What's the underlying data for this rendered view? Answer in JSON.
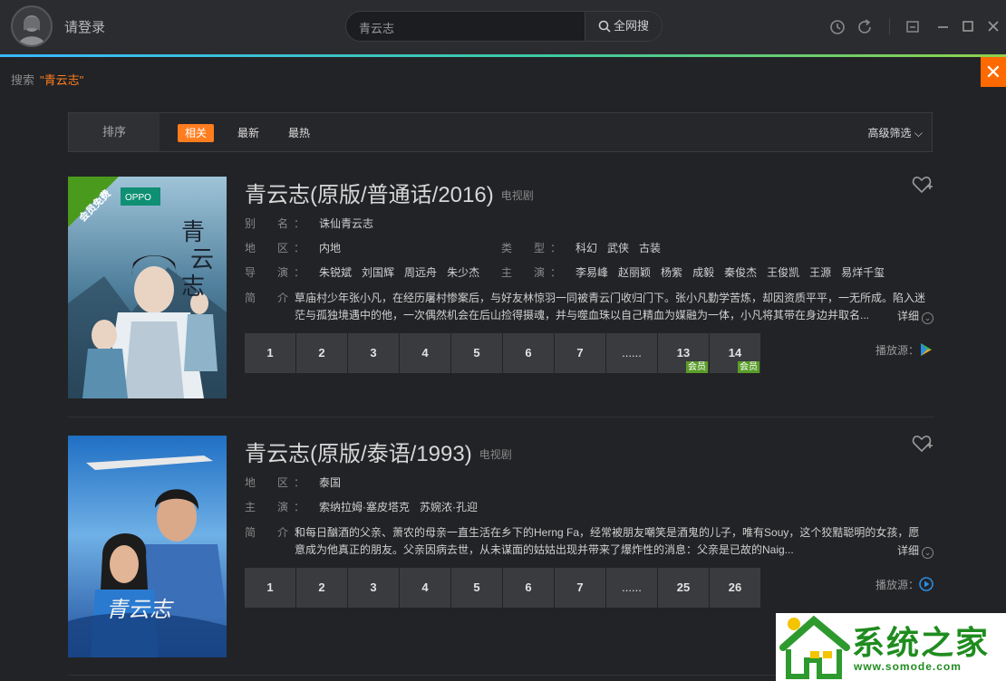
{
  "header": {
    "login_label": "请登录",
    "search_value": "青云志",
    "search_button_label": "全网搜"
  },
  "breadcrumb": {
    "label": "搜索",
    "query": "\"青云志\""
  },
  "sort": {
    "label": "排序",
    "options": [
      "相关",
      "最新",
      "最热"
    ],
    "active": "相关",
    "advanced_label": "高级筛选"
  },
  "results": [
    {
      "title": "青云志(原版/普通话/2016)",
      "type": "电视剧",
      "alias_key": "别　名：",
      "alias": "诛仙青云志",
      "region_key": "地　区：",
      "region": "内地",
      "genre_key": "类　型：",
      "genres": [
        "科幻",
        "武侠",
        "古装"
      ],
      "director_key": "导　演：",
      "directors": [
        "朱锐斌",
        "刘国辉",
        "周远舟",
        "朱少杰"
      ],
      "cast_key": "主　演：",
      "cast": [
        "李易峰",
        "赵丽颖",
        "杨紫",
        "成毅",
        "秦俊杰",
        "王俊凯",
        "王源",
        "易烊千玺"
      ],
      "desc_key": "简　介：",
      "description": "草庙村少年张小凡，在经历屠村惨案后，与好友林惊羽一同被青云门收归门下。张小凡勤学苦炼，却因资质平平，一无所成。陷入迷茫与孤独境遇中的他，一次偶然机会在后山捡得摄魂，并与噬血珠以自己精血为媒融为一体，小凡将其带在身边并取名...",
      "detail_label": "详细",
      "poster_badge": "会员免费",
      "poster_brand": "OPPO",
      "episodes": [
        {
          "label": "1",
          "vip": ""
        },
        {
          "label": "2",
          "vip": ""
        },
        {
          "label": "3",
          "vip": ""
        },
        {
          "label": "4",
          "vip": ""
        },
        {
          "label": "5",
          "vip": ""
        },
        {
          "label": "6",
          "vip": ""
        },
        {
          "label": "7",
          "vip": ""
        },
        {
          "label": "......",
          "vip": ""
        },
        {
          "label": "13",
          "vip": "会员"
        },
        {
          "label": "14",
          "vip": "会员"
        }
      ],
      "source_label": "播放源："
    },
    {
      "title": "青云志(原版/泰语/1993)",
      "type": "电视剧",
      "region_key": "地　区：",
      "region": "泰国",
      "cast_key": "主　演：",
      "cast": [
        "索纳拉姆·塞皮塔克",
        "苏婉浓·孔迎"
      ],
      "desc_key": "简　介：",
      "description": "和每日酗酒的父亲、萧农的母亲一直生活在乡下的Herng Fa，经常被朋友嘲笑是酒鬼的儿子，唯有Souy，这个狡黠聪明的女孩，愿意成为他真正的朋友。父亲因病去世，从未谋面的姑姑出现并带来了爆炸性的消息：父亲是已故的Naig...",
      "detail_label": "详细",
      "poster_text": "青云志",
      "episodes": [
        {
          "label": "1",
          "vip": ""
        },
        {
          "label": "2",
          "vip": ""
        },
        {
          "label": "3",
          "vip": ""
        },
        {
          "label": "4",
          "vip": ""
        },
        {
          "label": "5",
          "vip": ""
        },
        {
          "label": "6",
          "vip": ""
        },
        {
          "label": "7",
          "vip": ""
        },
        {
          "label": "......",
          "vip": ""
        },
        {
          "label": "25",
          "vip": ""
        },
        {
          "label": "26",
          "vip": ""
        }
      ],
      "source_label": "播放源："
    }
  ],
  "watermark": {
    "title": "系统之家",
    "url": "www.somode.com"
  },
  "colors": {
    "accent": "#ff7d1e",
    "vip_badge": "#5a9e2a",
    "background": "#222326"
  }
}
